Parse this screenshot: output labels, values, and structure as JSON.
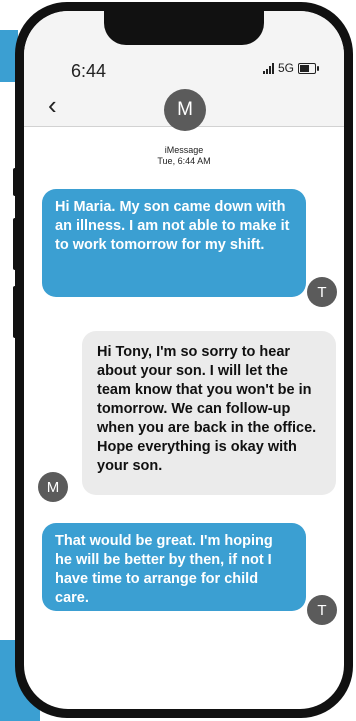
{
  "status_bar": {
    "time": "6:44",
    "network": "5G"
  },
  "conversation": {
    "contact_initial": "M",
    "service": "iMessage",
    "timestamp": "Tue, 6:44 AM"
  },
  "messages": [
    {
      "sender_initial": "T",
      "direction": "sent",
      "text": "Hi Maria. My son came down with an illness. I am not able to make it to work tomorrow for my shift."
    },
    {
      "sender_initial": "M",
      "direction": "received",
      "text": "Hi Tony, I'm so sorry to hear about your son. I will let the team know that you won't be in tomorrow. We can follow-up when you are back in the office.  Hope everything is okay with your son."
    },
    {
      "sender_initial": "T",
      "direction": "sent",
      "text": "That would be great. I'm hoping he will be better by then, if not I have time to arrange for child care."
    }
  ],
  "icons": {
    "back": "chevron-left-icon",
    "signal": "signal-bars-icon",
    "battery": "battery-icon"
  },
  "colors": {
    "sent_bubble": "#3b9fd2",
    "received_bubble": "#ebebeb",
    "avatar": "#5b5b5b",
    "backdrop": "#3b9fd2"
  }
}
